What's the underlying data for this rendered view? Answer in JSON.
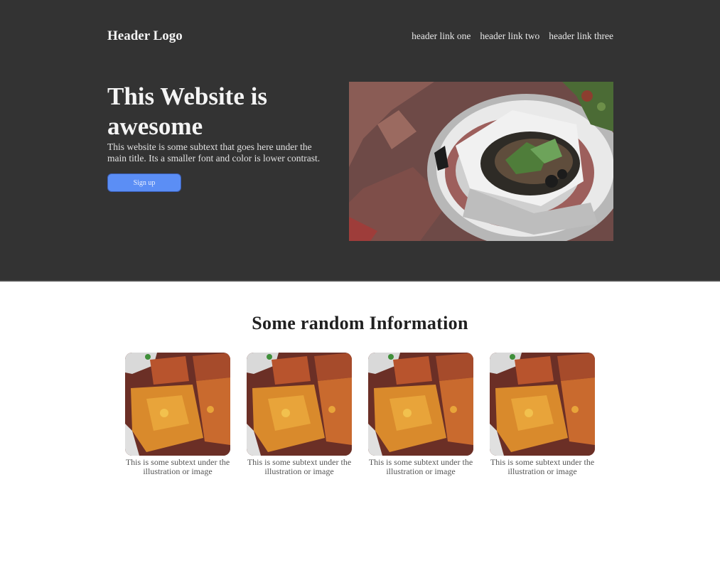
{
  "header": {
    "logo": "Header Logo",
    "links": [
      "header link one",
      "header link two",
      "header link three"
    ]
  },
  "hero": {
    "title": "This Website is awesome",
    "subtext": "This website is some subtext that goes here under the main title. Its a smaller font and color is lower contrast.",
    "cta_label": "Sign up",
    "image_alt": "bowl of food"
  },
  "info": {
    "title": "Some random Information",
    "cards": [
      {
        "caption": "This is some subtext under the illustration or image"
      },
      {
        "caption": "This is some subtext under the illustration or image"
      },
      {
        "caption": "This is some subtext under the illustration or image"
      },
      {
        "caption": "This is some subtext under the illustration or image"
      }
    ]
  },
  "colors": {
    "hero_bg": "#333333",
    "button": "#5b8ef5",
    "page_bg": "#ffffff"
  }
}
